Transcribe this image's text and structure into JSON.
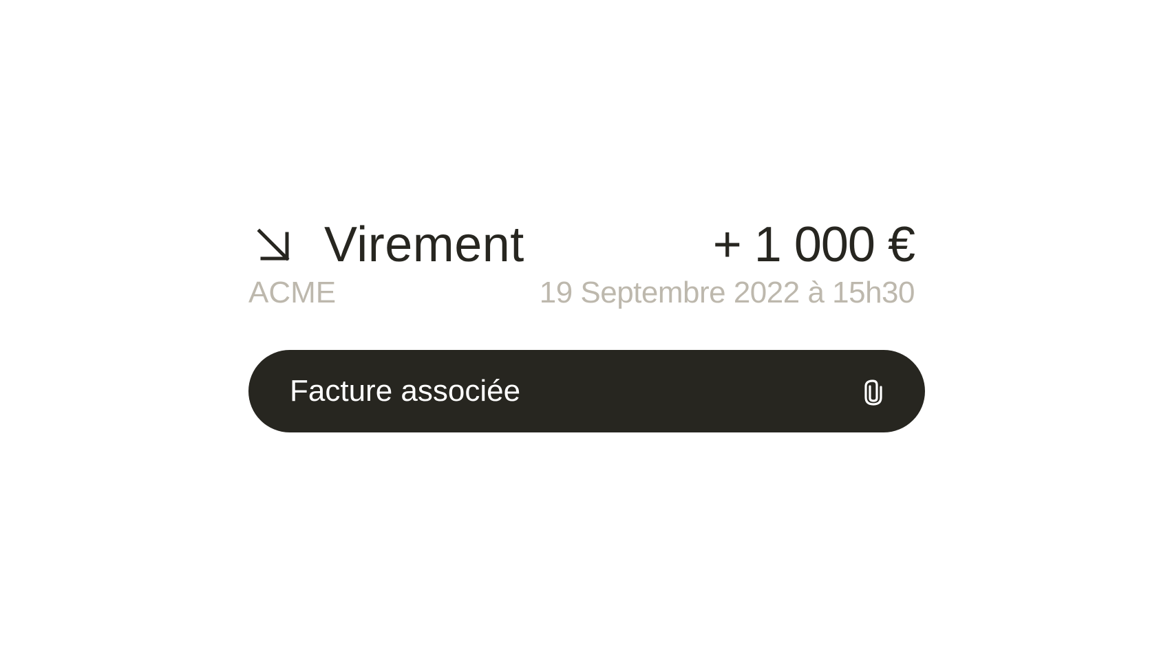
{
  "transaction": {
    "direction_icon": "arrow-down-right-icon",
    "title": "Virement",
    "amount": "+ 1 000 €",
    "counterparty": "ACME",
    "datetime": "19 Septembre 2022 à 15h30"
  },
  "invoice": {
    "label": "Facture associée",
    "icon": "paperclip-icon"
  },
  "colors": {
    "text_primary": "#272620",
    "text_secondary": "#bdb8ad",
    "button_bg": "#272620",
    "button_text": "#ffffff",
    "background": "#ffffff"
  }
}
